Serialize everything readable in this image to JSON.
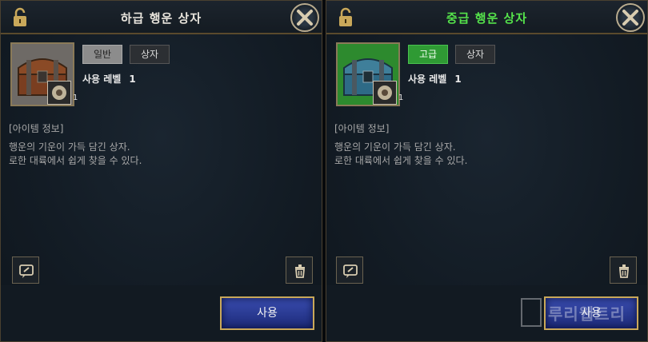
{
  "left": {
    "title": "하급 행운 상자",
    "grade": "일반",
    "type": "상자",
    "use_level_label": "사용 레벨",
    "use_level": "1",
    "engrave_count": "1",
    "info_head": "[아이템 정보]",
    "desc_line1": "행운의 기운이 가득 담긴 상자.",
    "desc_line2": "로한 대륙에서 쉽게 찾을 수 있다.",
    "use_label": "사용"
  },
  "right": {
    "title": "중급 행운 상자",
    "grade": "고급",
    "type": "상자",
    "use_level_label": "사용 레벨",
    "use_level": "1",
    "engrave_count": "1",
    "info_head": "[아이템 정보]",
    "desc_line1": "행운의 기운이 가득 담긴 상자.",
    "desc_line2": "로한 대륙에서 쉽게 찾을 수 있다.",
    "use_label": "사용"
  },
  "watermark": "루리웹트리",
  "colors": {
    "grade_normal": "#8c8c8c",
    "grade_high": "#2f9a34",
    "title_high": "#55e34b",
    "accent_gold": "#c9a85a"
  }
}
